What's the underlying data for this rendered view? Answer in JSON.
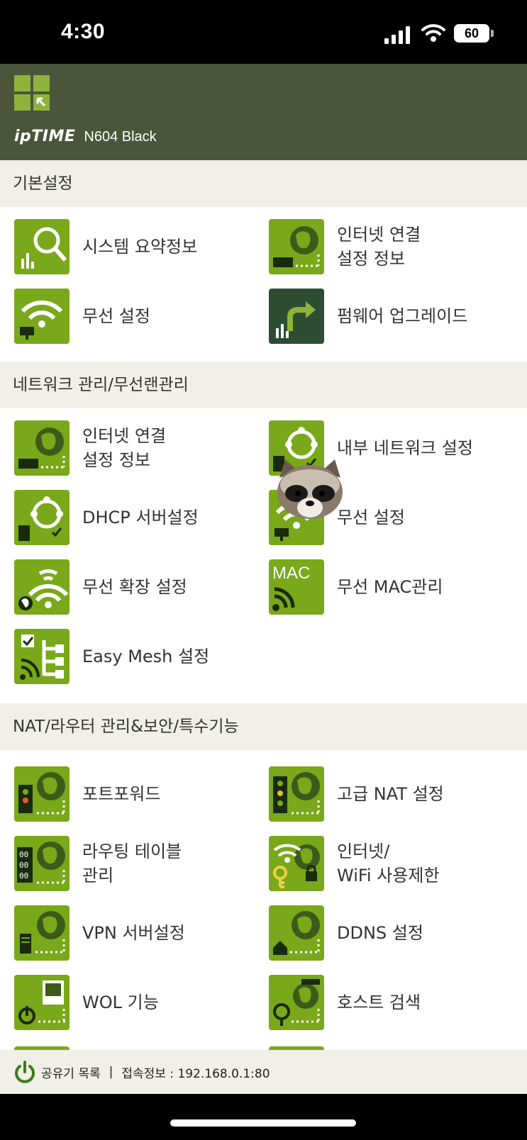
{
  "status_bar": {
    "time": "4:30",
    "battery": "60"
  },
  "header": {
    "brand": "ipTIME",
    "model": "N604 Black"
  },
  "sections": [
    {
      "title": "기본설정",
      "items": [
        {
          "label": "시스템 요약정보",
          "icon": "system-summary-icon"
        },
        {
          "label": "인터넷 연결\n설정 정보",
          "icon": "internet-connection-icon"
        },
        {
          "label": "무선 설정",
          "icon": "wireless-icon"
        },
        {
          "label": "펌웨어 업그레이드",
          "icon": "firmware-upgrade-icon"
        }
      ]
    },
    {
      "title": "네트워크 관리/무선랜관리",
      "items": [
        {
          "label": "인터넷 연결\n설정 정보",
          "icon": "internet-connection-icon"
        },
        {
          "label": "내부 네트워크 설정",
          "icon": "internal-network-icon"
        },
        {
          "label": "DHCP 서버설정",
          "icon": "dhcp-icon"
        },
        {
          "label": "무선 설정",
          "icon": "wireless-icon"
        },
        {
          "label": "무선 확장 설정",
          "icon": "wireless-extension-icon"
        },
        {
          "label": "무선 MAC관리",
          "icon": "mac-icon",
          "icon_text": "MAC"
        },
        {
          "label": "Easy Mesh 설정",
          "icon": "mesh-icon"
        }
      ]
    },
    {
      "title": "NAT/라우터 관리&보안/특수기능",
      "items": [
        {
          "label": "포트포워드",
          "icon": "port-forward-icon"
        },
        {
          "label": "고급 NAT 설정",
          "icon": "advanced-nat-icon"
        },
        {
          "label": "라우팅 테이블\n관리",
          "icon": "routing-table-icon"
        },
        {
          "label": "인터넷/\nWiFi 사용제한",
          "icon": "internet-limit-icon"
        },
        {
          "label": "VPN 서버설정",
          "icon": "vpn-icon"
        },
        {
          "label": "DDNS 설정",
          "icon": "ddns-icon"
        },
        {
          "label": "WOL 기능",
          "icon": "wol-icon"
        },
        {
          "label": "호스트 검색",
          "icon": "host-search-icon"
        }
      ]
    }
  ],
  "footer": {
    "router_list": "공유기 목록",
    "separator": "|",
    "connection_info": "접속정보 : 192.168.0.1:80"
  },
  "colors": {
    "header_bg": "#4a553a",
    "tile_green": "#79a81a",
    "tile_dark": "#2d4d33",
    "section_bg": "#f0f0e8"
  }
}
